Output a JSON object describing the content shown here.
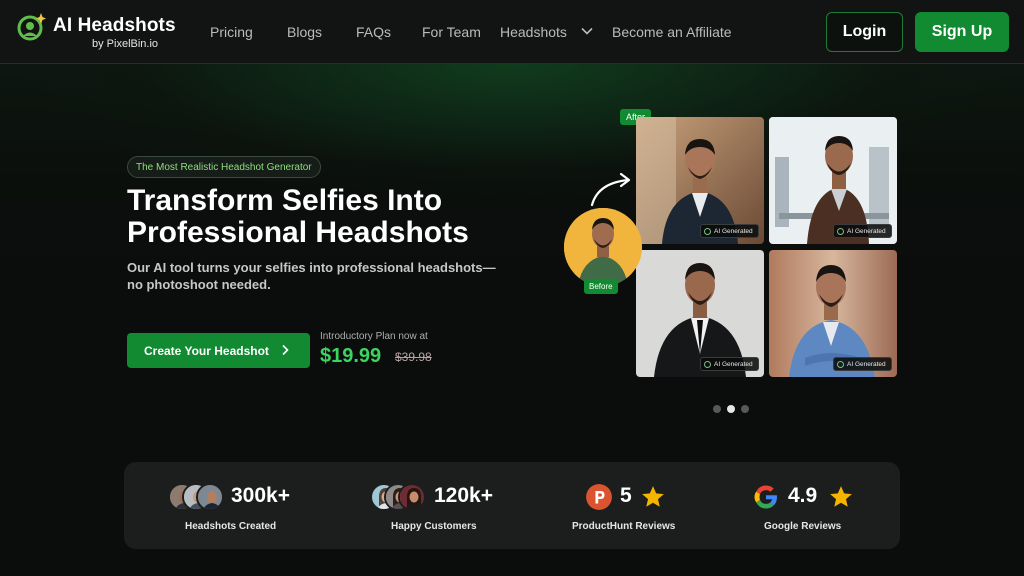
{
  "brand": {
    "title": "AI Headshots",
    "subtitle": "by PixelBin.io"
  },
  "nav": {
    "links": [
      "Pricing",
      "Blogs",
      "FAQs",
      "For Team",
      "Headshots",
      "Become an Affiliate"
    ],
    "login": "Login",
    "signup": "Sign Up"
  },
  "hero": {
    "pill": "The Most Realistic Headshot Generator",
    "title_line1": "Transform Selfies Into",
    "title_line2": "Professional Headshots",
    "desc_line1": "Our AI tool turns your selfies into professional headshots—",
    "desc_line2": "no photoshoot needed.",
    "cta": "Create Your Headshot",
    "intro": "Introductory Plan now at",
    "price": "$19.99",
    "old_price": "$39.98"
  },
  "gallery": {
    "after_tag": "After",
    "before_tag": "Before",
    "badge": "AI Generated",
    "carousel_dots": 3,
    "active_dot": 1
  },
  "stats": [
    {
      "value": "300k+",
      "label": "Headshots Created"
    },
    {
      "value": "120k+",
      "label": "Happy Customers"
    },
    {
      "value": "5",
      "label": "ProductHunt Reviews",
      "icon": "producthunt-icon"
    },
    {
      "value": "4.9",
      "label": "Google Reviews",
      "icon": "google-icon"
    }
  ],
  "colors": {
    "accent": "#118a32",
    "price": "#3bd45e",
    "star": "#f5b400",
    "producthunt": "#da552f"
  }
}
